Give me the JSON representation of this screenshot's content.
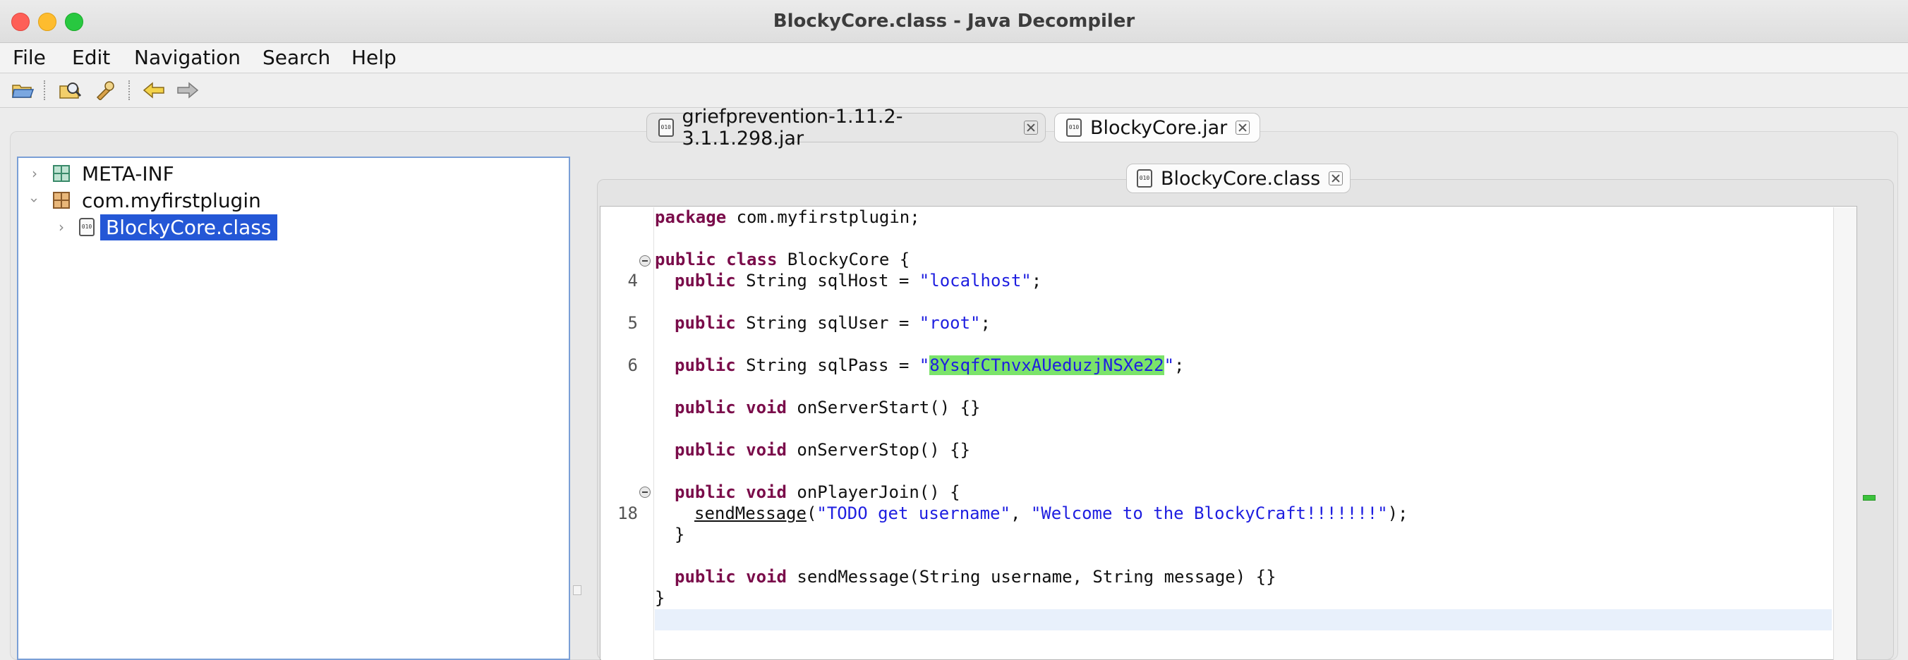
{
  "window": {
    "title": "BlockyCore.class - Java Decompiler"
  },
  "menu": {
    "items": [
      "File",
      "Edit",
      "Navigation",
      "Search",
      "Help"
    ]
  },
  "toolbar": {
    "icons": [
      "open-file-icon",
      "open-type-icon",
      "search-tool-icon",
      "back-arrow-icon",
      "forward-arrow-icon"
    ]
  },
  "jar_tabs": [
    {
      "label": "griefprevention-1.11.2-3.1.1.298.jar",
      "active": false
    },
    {
      "label": "BlockyCore.jar",
      "active": true
    }
  ],
  "tree": {
    "items": [
      {
        "label": "META-INF",
        "expanded": false,
        "icon": "folder-icon"
      },
      {
        "label": "com.myfirstplugin",
        "expanded": true,
        "icon": "package-icon"
      },
      {
        "label": "BlockyCore.class",
        "expanded": false,
        "icon": "class-file-icon",
        "selected": true
      }
    ]
  },
  "editor": {
    "tab_label": "BlockyCore.class",
    "line_numbers": [
      "4",
      "5",
      "6",
      "18"
    ],
    "code": {
      "package_kw": "package",
      "package_name": " com.myfirstplugin;",
      "class_kw": "public class",
      "class_name": " BlockyCore {",
      "public_kw": "public",
      "void_kw": "void",
      "string_type": " String ",
      "field_host": "sqlHost = ",
      "field_user": "sqlUser = ",
      "field_pass": "sqlPass = ",
      "quote": "\"",
      "value_host": "\"localhost\"",
      "value_user": "\"root\"",
      "value_pass": "8YsqfCTnvxAUeduzjNSXe22",
      "semicolon": ";",
      "method_start": " onServerStart() {}",
      "method_stop": " onServerStop() {}",
      "method_join": " onPlayerJoin() {",
      "call_name": "sendMessage",
      "call_open": "(",
      "arg1": "\"TODO get username\"",
      "comma": ", ",
      "arg2": "\"Welcome to the BlockyCraft!!!!!!!\"",
      "call_close": ");",
      "close_brace": "}",
      "method_send": " sendMessage(String username, String message) {}"
    }
  },
  "colors": {
    "keyword": "#7a0c4a",
    "string": "#1e1ee0",
    "selection": "#2457d6",
    "highlight": "#7be36a"
  }
}
